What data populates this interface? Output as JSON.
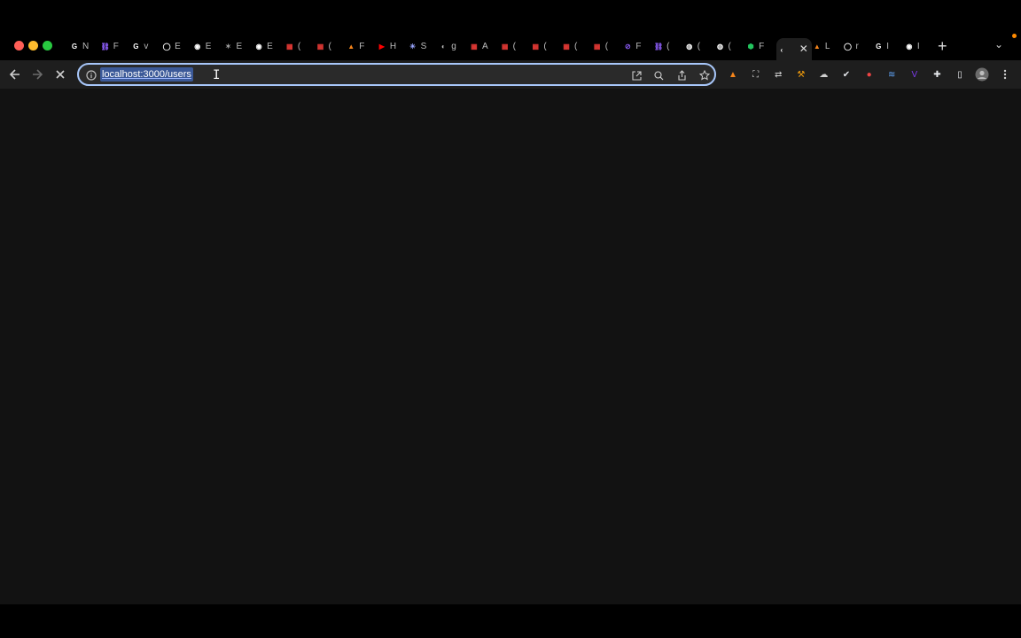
{
  "browser": {
    "address_bar": {
      "value": "localhost:3000/users"
    },
    "tabs": [
      {
        "icon": "google-icon",
        "color": "#ffffff",
        "initial": "G",
        "label": "N"
      },
      {
        "icon": "link-icon",
        "color": "#8b5cf6",
        "initial": "⛓",
        "label": "F"
      },
      {
        "icon": "chrome-icon",
        "color": "#ffffff",
        "initial": "G",
        "label": "v"
      },
      {
        "icon": "github-icon",
        "color": "#ffffff",
        "initial": "◯",
        "label": "E"
      },
      {
        "icon": "globe-icon",
        "color": "#ffffff",
        "initial": "◉",
        "label": "E"
      },
      {
        "icon": "spider-icon",
        "color": "#9e9e9e",
        "initial": "✶",
        "label": "E"
      },
      {
        "icon": "globe-icon",
        "color": "#ffffff",
        "initial": "◉",
        "label": "E"
      },
      {
        "icon": "grid-icon",
        "color": "#e53935",
        "initial": "▦",
        "label": "("
      },
      {
        "icon": "grid-icon",
        "color": "#e53935",
        "initial": "▦",
        "label": "("
      },
      {
        "icon": "fox-icon",
        "color": "#f6851b",
        "initial": "▲",
        "label": "F"
      },
      {
        "icon": "youtube-icon",
        "color": "#ff0000",
        "initial": "▶",
        "label": "H"
      },
      {
        "icon": "snowflake-icon",
        "color": "#9aa6ff",
        "initial": "✳",
        "label": "S"
      },
      {
        "icon": "globe-icon",
        "color": "#bdbdbd",
        "initial": "◐",
        "label": "g"
      },
      {
        "icon": "grid-icon",
        "color": "#e53935",
        "initial": "▦",
        "label": "A"
      },
      {
        "icon": "grid-icon",
        "color": "#e53935",
        "initial": "▦",
        "label": "("
      },
      {
        "icon": "grid-icon",
        "color": "#e53935",
        "initial": "▦",
        "label": "("
      },
      {
        "icon": "grid-icon",
        "color": "#e53935",
        "initial": "▦",
        "label": "("
      },
      {
        "icon": "grid-icon",
        "color": "#e53935",
        "initial": "▦",
        "label": "("
      },
      {
        "icon": "link-icon",
        "color": "#8b5cf6",
        "initial": "⊘",
        "label": "F"
      },
      {
        "icon": "link-icon",
        "color": "#8b5cf6",
        "initial": "⛓",
        "label": "("
      },
      {
        "icon": "ring-icon",
        "color": "#ffffff",
        "initial": "◍",
        "label": "("
      },
      {
        "icon": "ring-icon",
        "color": "#ffffff",
        "initial": "◍",
        "label": "("
      },
      {
        "icon": "cube-icon",
        "color": "#22c55e",
        "initial": "⬢",
        "label": "F"
      },
      {
        "icon": "active-tab-icon",
        "color": "#ffffff",
        "initial": "‹",
        "label": ""
      },
      {
        "icon": "fox-icon",
        "color": "#f6851b",
        "initial": "▲",
        "label": "L"
      },
      {
        "icon": "github-icon",
        "color": "#ffffff",
        "initial": "◯",
        "label": "r"
      },
      {
        "icon": "google-icon",
        "color": "#ffffff",
        "initial": "G",
        "label": "I"
      },
      {
        "icon": "chrome-icon",
        "color": "#ffffff",
        "initial": "◉",
        "label": "I"
      }
    ],
    "new_tab": "+",
    "tab_search": "⌄",
    "extensions": [
      {
        "icon": "metamask-icon",
        "color": "#f6851b",
        "glyph": "▲"
      },
      {
        "icon": "screenshot-icon",
        "color": "#cfcfcf",
        "glyph": "⛶"
      },
      {
        "icon": "translate-icon",
        "color": "#cfcfcf",
        "glyph": "⇄"
      },
      {
        "icon": "hammer-icon",
        "color": "#f59e0b",
        "glyph": "⚒"
      },
      {
        "icon": "cloud-icon",
        "color": "#cfcfcf",
        "glyph": "☁"
      },
      {
        "icon": "check-circle-icon",
        "color": "#e5e7eb",
        "glyph": "✔"
      },
      {
        "icon": "flame-icon",
        "color": "#ef4444",
        "glyph": "●"
      },
      {
        "icon": "wave-icon",
        "color": "#60a5fa",
        "glyph": "≋"
      },
      {
        "icon": "v-icon",
        "color": "#7c3aed",
        "glyph": "V"
      },
      {
        "icon": "puzzle-icon",
        "color": "#e5e7eb",
        "glyph": "✚"
      },
      {
        "icon": "sidepanel-icon",
        "color": "#e5e7eb",
        "glyph": "▯"
      }
    ]
  }
}
